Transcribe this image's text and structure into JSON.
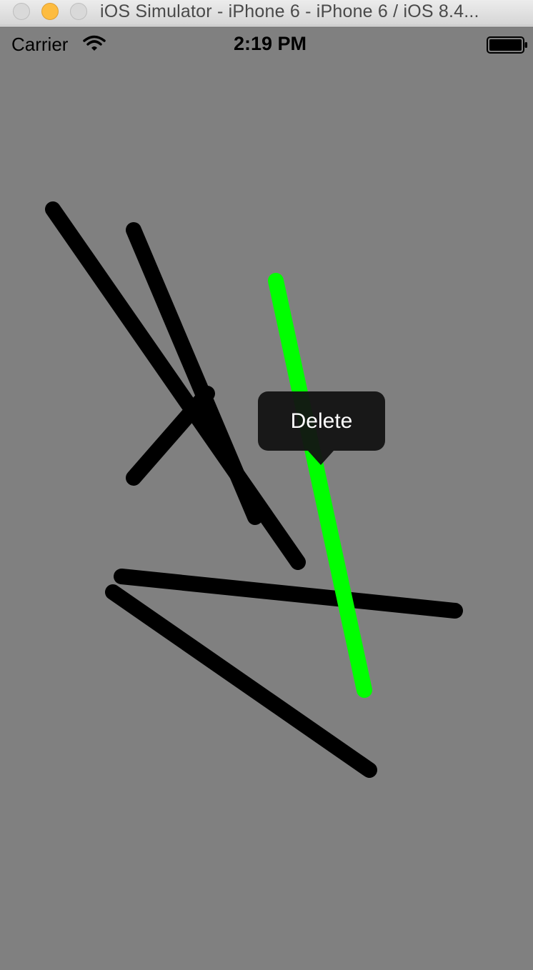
{
  "window": {
    "title": "iOS Simulator - iPhone 6 - iPhone 6 / iOS 8.4..."
  },
  "status_bar": {
    "carrier": "Carrier",
    "time": "2:19 PM",
    "wifi_icon": "wifi-icon",
    "battery_icon": "battery-icon",
    "battery_level": 1.0
  },
  "canvas": {
    "background_color": "#808080",
    "selected_line_color": "#00ff00",
    "line_color": "#000000"
  },
  "context_menu": {
    "items": [
      {
        "label": "Delete"
      }
    ]
  },
  "colors": {
    "traffic_close": "#d9d9d9",
    "traffic_minimize": "#fdbc40",
    "traffic_zoom": "#d9d9d9"
  }
}
